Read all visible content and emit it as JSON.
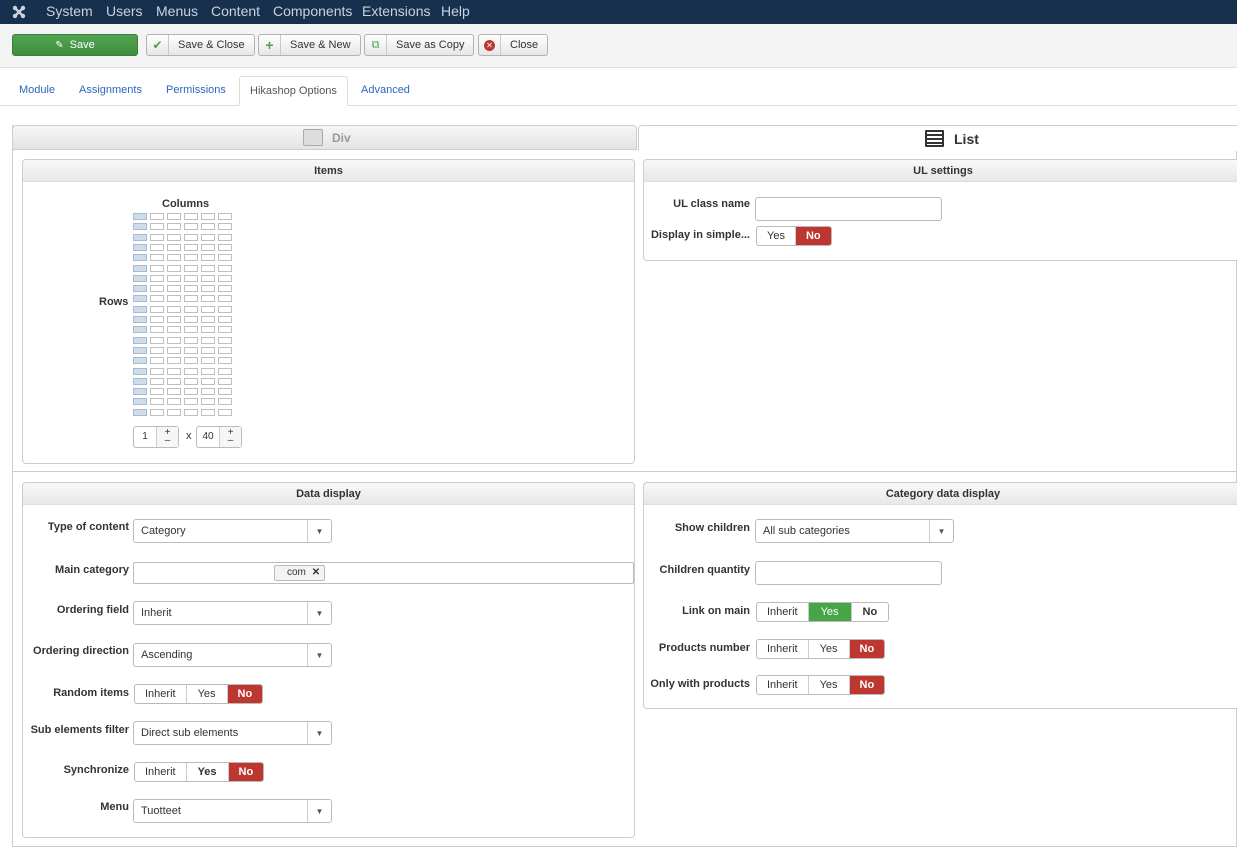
{
  "topbar": {
    "menu": [
      "System",
      "Users",
      "Menus",
      "Content",
      "Components",
      "Extensions",
      "Help"
    ]
  },
  "toolbar": {
    "save_label": "Save",
    "save_close_label": "Save & Close",
    "save_new_label": "Save & New",
    "save_copy_label": "Save as Copy",
    "close_label": "Close"
  },
  "tabs": [
    "Module",
    "Assignments",
    "Permissions",
    "Hikashop Options",
    "Advanced"
  ],
  "active_tab": "Hikashop Options",
  "layout_choices": {
    "div_label": "Div",
    "list_label": "List",
    "selected": "List"
  },
  "items_panel": {
    "title": "Items",
    "columns_label": "Columns",
    "rows_label": "Rows",
    "columns_value": "1",
    "times": "x",
    "rows_value": "40",
    "plus": "+",
    "minus": "–"
  },
  "ul_settings": {
    "title": "UL settings",
    "class_name_label": "UL class name",
    "class_name_value": "",
    "simple_label": "Display in simple...",
    "simple_options": [
      "Yes",
      "No"
    ],
    "simple_selected": "No"
  },
  "data_display": {
    "title": "Data display",
    "type_label": "Type of content",
    "type_value": "Category",
    "main_cat_label": "Main category",
    "main_cat_tag": "com",
    "ordering_field_label": "Ordering field",
    "ordering_field_value": "Inherit",
    "ordering_dir_label": "Ordering direction",
    "ordering_dir_value": "Ascending",
    "random_label": "Random items",
    "random_options": [
      "Inherit",
      "Yes",
      "No"
    ],
    "random_selected": "No",
    "sub_filter_label": "Sub elements filter",
    "sub_filter_value": "Direct sub elements",
    "sync_label": "Synchronize",
    "sync_options": [
      "Inherit",
      "Yes",
      "No"
    ],
    "sync_selected": "No",
    "menu_label": "Menu",
    "menu_value": "Tuotteet"
  },
  "category_display": {
    "title": "Category data display",
    "show_children_label": "Show children",
    "show_children_value": "All sub categories",
    "children_qty_label": "Children quantity",
    "children_qty_value": "",
    "link_main_label": "Link on main",
    "link_main_options": [
      "Inherit",
      "Yes",
      "No"
    ],
    "link_main_selected": "Yes",
    "products_number_label": "Products number",
    "products_number_options": [
      "Inherit",
      "Yes",
      "No"
    ],
    "products_number_selected": "No",
    "only_products_label": "Only with products",
    "only_products_options": [
      "Inherit",
      "Yes",
      "No"
    ],
    "only_products_selected": "No"
  },
  "colors": {
    "topbar": "#17304e",
    "save_green": "#46a546",
    "no_red": "#bd362f",
    "link_blue": "#2a69b8"
  },
  "grid_state": {
    "columns_shown": 6,
    "rows_shown": 20,
    "selected_columns": 1,
    "selected_rows": 20
  }
}
